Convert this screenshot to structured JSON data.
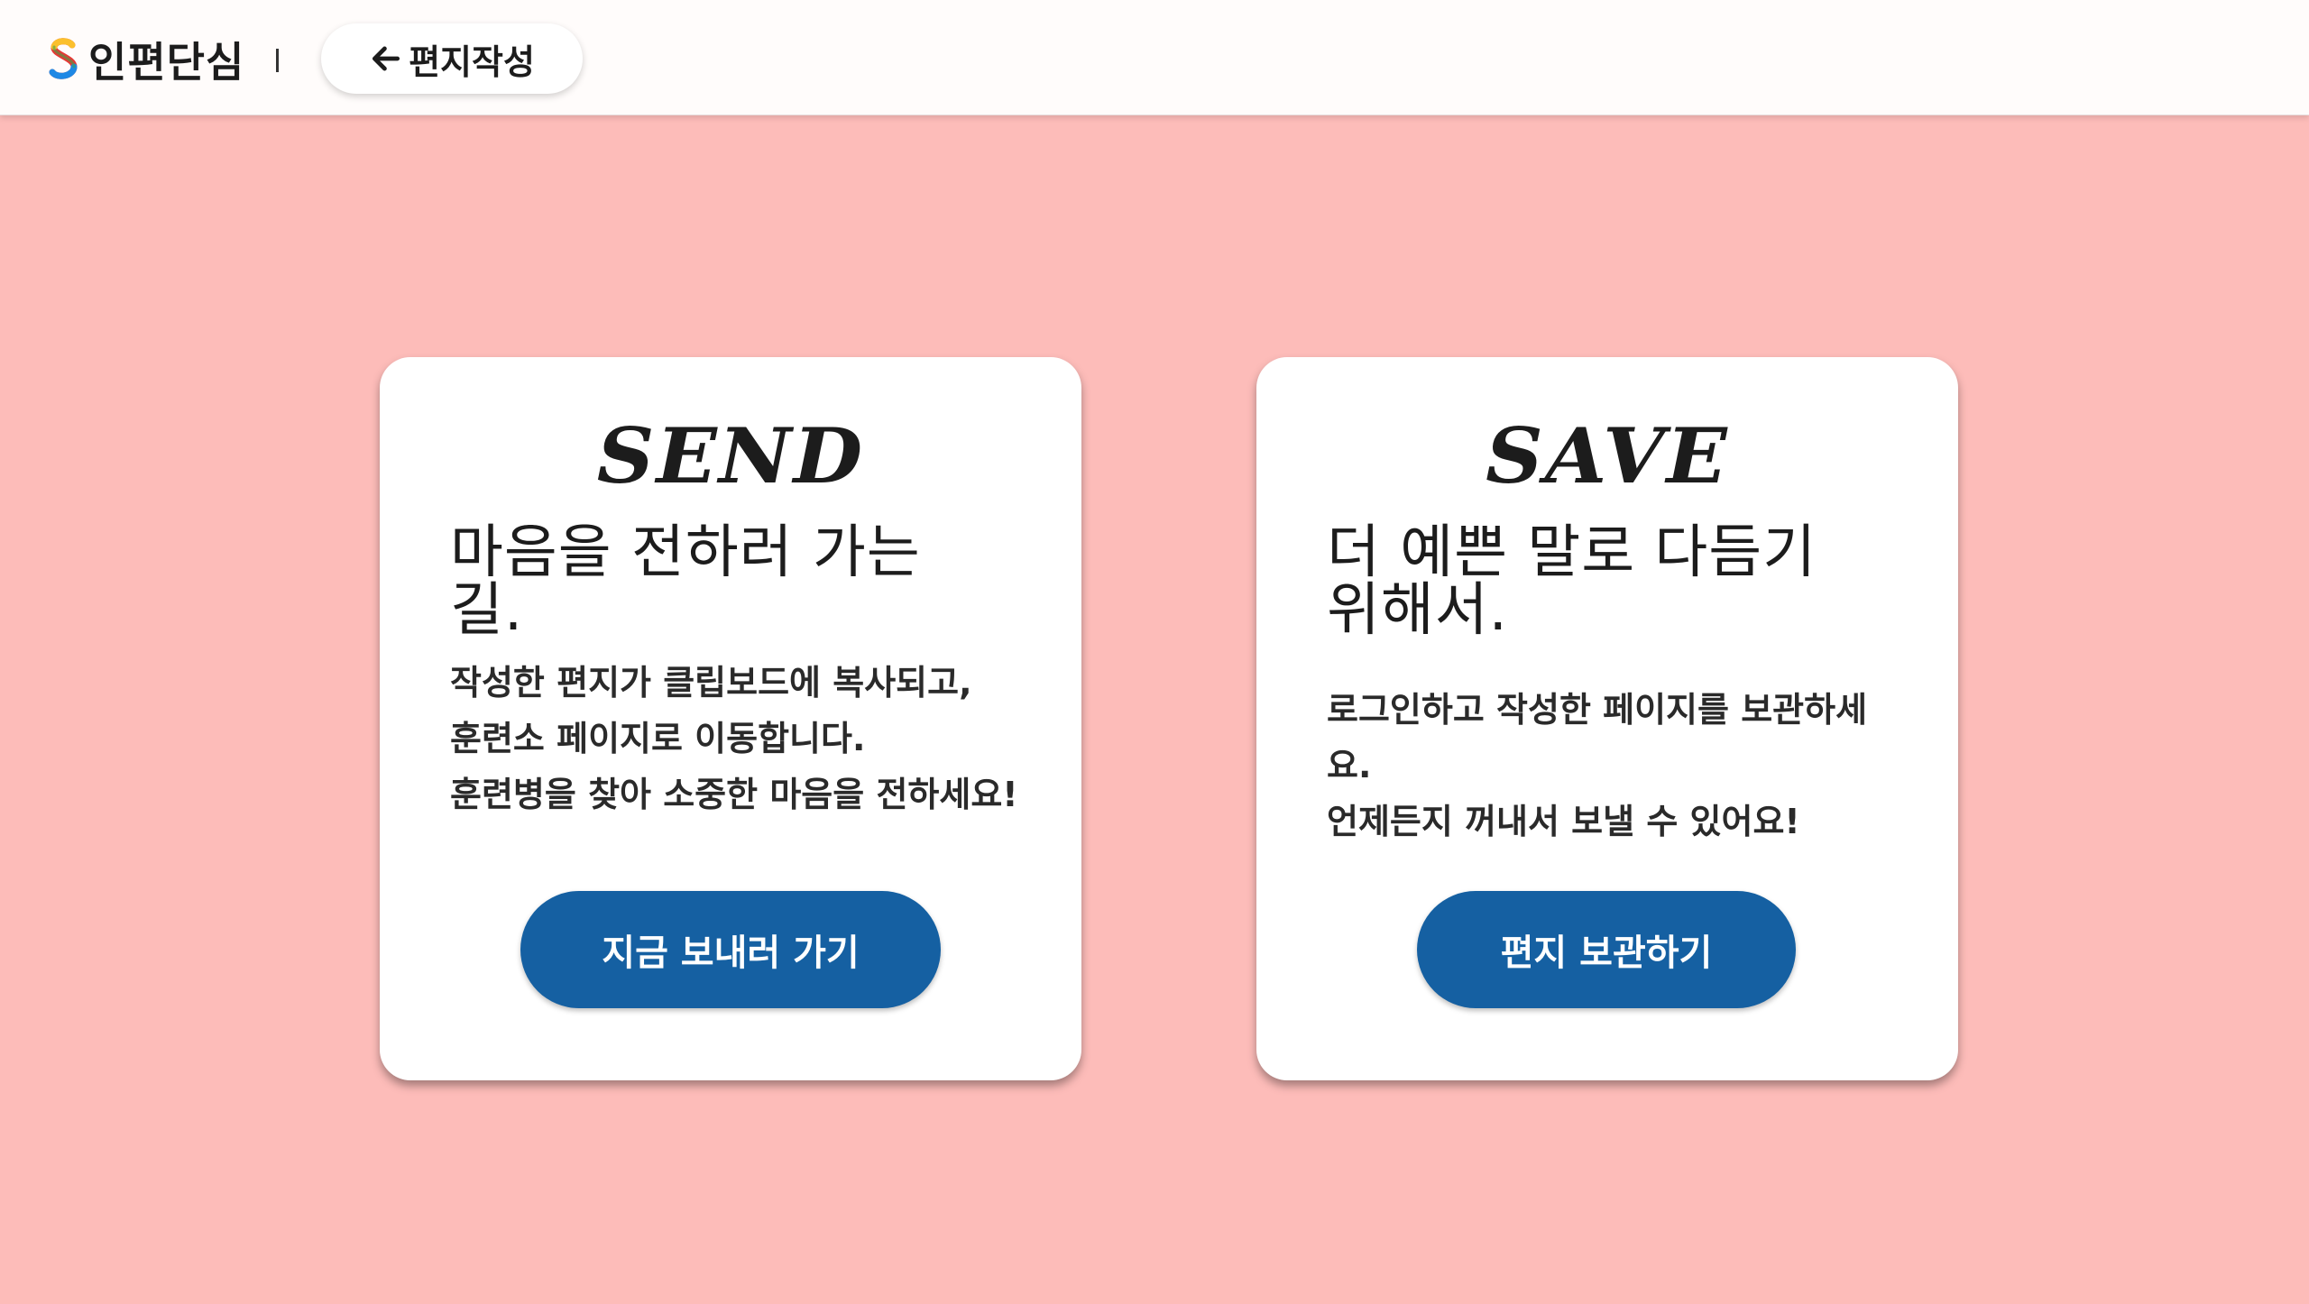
{
  "header": {
    "logo_text": "인편단심",
    "back_button_label": "편지작성",
    "back_icon": "arrow-left-icon"
  },
  "cards": {
    "send": {
      "title": "SEND",
      "headline": "마음을 전하러 가는 길.",
      "description": "작성한 편지가 클립보드에 복사되고,\n   훈련소 페이지로 이동합니다.\n훈련병을 찾아 소중한 마음을 전하세요!",
      "button_label": "지금 보내러 가기"
    },
    "save": {
      "title": "SAVE",
      "headline": "더 예쁜 말로 다듬기 위해서.",
      "description": "로그인하고 작성한 페이지를 보관하세요.\n   언제든지 꺼내서 보낼 수 있어요!",
      "button_label": "편지 보관하기"
    }
  },
  "colors": {
    "background": "#fdbcb9",
    "header_background": "#fffcfb",
    "card_background": "#ffffff",
    "button_primary": "#1560a2",
    "button_text": "#ffffff"
  }
}
